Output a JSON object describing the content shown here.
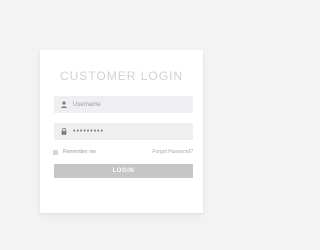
{
  "form": {
    "title": "CUSTOMER LOGIN",
    "username": {
      "placeholder": "Username",
      "icon": "user-icon"
    },
    "password": {
      "value": "•••••••••",
      "icon": "lock-icon"
    },
    "remember_label": "Remember me",
    "forgot_label": "Forgot Password?",
    "login_label": "LOGIN"
  },
  "colors": {
    "background": "#f3f3f4",
    "card": "#ffffff",
    "field": "#efeff2",
    "button": "#c6c6c8",
    "title": "#d2d2d6"
  }
}
